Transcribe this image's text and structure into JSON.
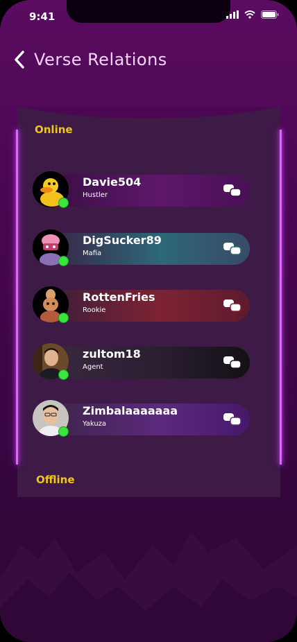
{
  "status_bar": {
    "time": "9:41"
  },
  "header": {
    "title": "Verse Relations"
  },
  "sections": {
    "online_label": "Online",
    "offline_label": "Offline"
  },
  "friends": [
    {
      "name": "Davie504",
      "rank": "Hustler",
      "status": "online",
      "avatar": "duck-avatar",
      "pill_color": "#5a1666"
    },
    {
      "name": "DigSucker89",
      "rank": "Mafia",
      "status": "online",
      "avatar": "masked-avatar",
      "pill_color": "#2f6a78"
    },
    {
      "name": "RottenFries",
      "rank": "Rookie",
      "status": "online",
      "avatar": "doll-avatar",
      "pill_color": "#7b2231"
    },
    {
      "name": "zultom18",
      "rank": "Agent",
      "status": "online",
      "avatar": "person-avatar",
      "pill_color": "#1d1420"
    },
    {
      "name": "Zimbalaaaaaaa",
      "rank": "Yakuza",
      "status": "online",
      "avatar": "person-avatar",
      "pill_color": "#54237a"
    }
  ],
  "icons": {
    "back": "chevron-left-icon",
    "chat": "chat-bubbles-icon",
    "online": "online-dot-icon"
  },
  "colors": {
    "section_label": "#f0c51c",
    "online_dot": "#39e63c",
    "panel": "#3e1a46",
    "edge_glow": "#e065ff"
  }
}
